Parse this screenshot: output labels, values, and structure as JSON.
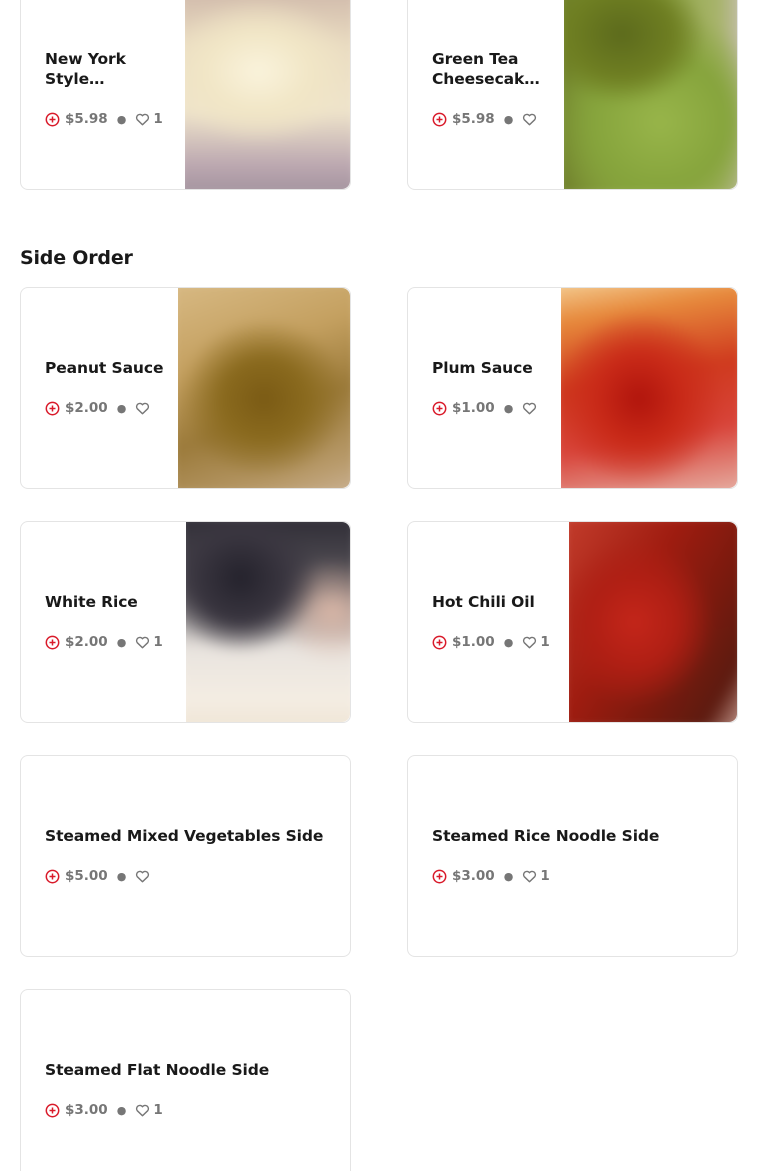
{
  "sections": [
    {
      "title": "",
      "items": [
        {
          "name": "New York Style…",
          "price": "$5.98",
          "likes": "1",
          "image": "cheesecake-photo"
        },
        {
          "name": "Green Tea Cheesecak…",
          "price": "$5.98",
          "likes": "",
          "image": "green-tea-cheesecake-photo"
        }
      ]
    },
    {
      "title": "Side Order",
      "items": [
        {
          "name": "Peanut Sauce",
          "price": "$2.00",
          "likes": "",
          "image": "peanut-sauce-photo"
        },
        {
          "name": "Plum Sauce",
          "price": "$1.00",
          "likes": "",
          "image": "plum-sauce-photo"
        },
        {
          "name": "White Rice",
          "price": "$2.00",
          "likes": "1",
          "image": "white-rice-photo"
        },
        {
          "name": "Hot Chili Oil",
          "price": "$1.00",
          "likes": "1",
          "image": "hot-chili-oil-photo"
        },
        {
          "name": "Steamed Mixed Vegetables Side",
          "price": "$5.00",
          "likes": ""
        },
        {
          "name": "Steamed Rice Noodle Side",
          "price": "$3.00",
          "likes": "1"
        },
        {
          "name": "Steamed Flat Noodle Side",
          "price": "$3.00",
          "likes": "1"
        }
      ]
    }
  ],
  "icons": {
    "add": "add-circle-icon",
    "like": "heart-outline-icon"
  },
  "colors": {
    "accent": "#d91a2a",
    "text": "#191919",
    "muted": "#767676",
    "border": "#e4e4e4"
  }
}
